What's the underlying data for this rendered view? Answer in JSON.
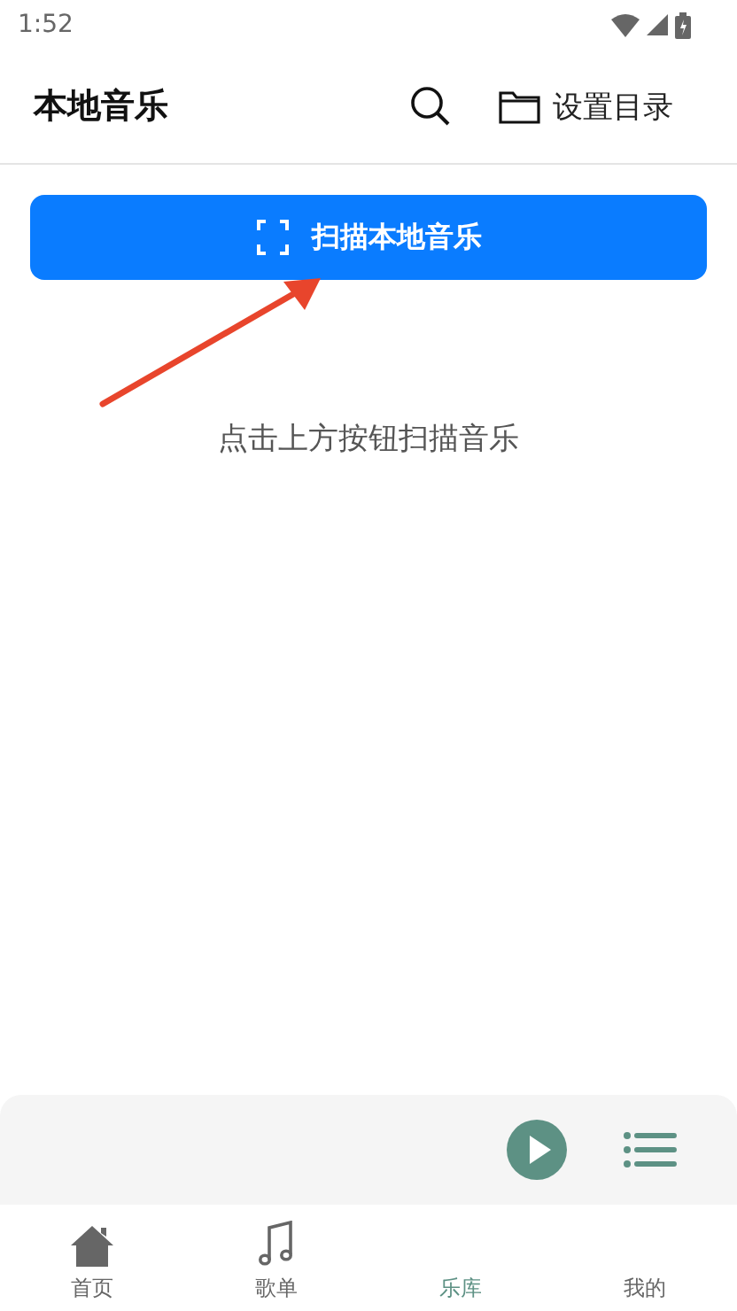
{
  "status_bar": {
    "time": "1:52"
  },
  "header": {
    "title": "本地音乐",
    "folder_label": "设置目录"
  },
  "scan_button": {
    "label": "扫描本地音乐"
  },
  "hint": "点击上方按钮扫描音乐",
  "player": {
    "playing": false
  },
  "tabs": [
    {
      "label": "首页",
      "kind": "home",
      "selected": false
    },
    {
      "label": "歌单",
      "kind": "note",
      "selected": false
    },
    {
      "label": "乐库",
      "kind": "none",
      "selected": true
    },
    {
      "label": "我的",
      "kind": "none",
      "selected": false
    }
  ]
}
